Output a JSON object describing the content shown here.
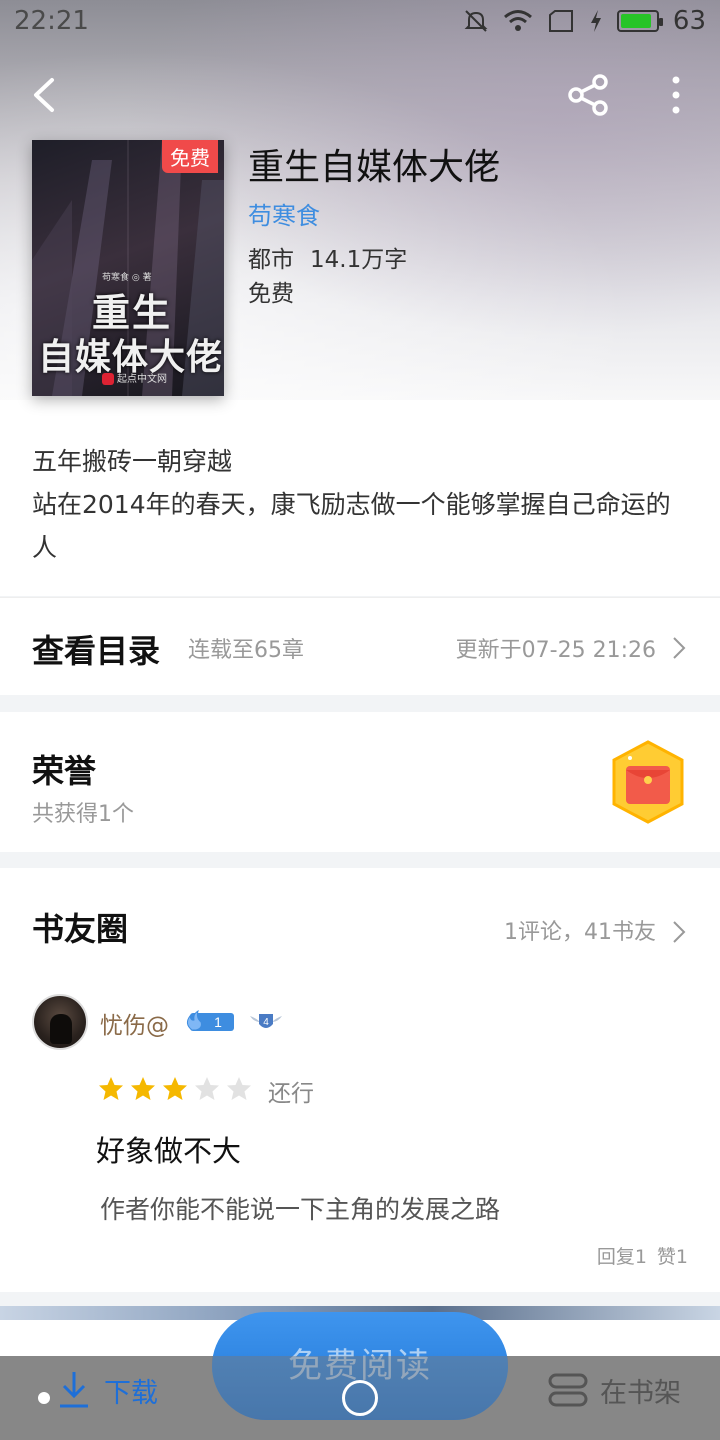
{
  "status_bar": {
    "time": "22:21",
    "battery": "63"
  },
  "book": {
    "cover_badge": "免费",
    "cover_author": "苟寒食 ◎ 著",
    "cover_title_line1": "重生",
    "cover_title_line2": "自媒体大佬",
    "cover_publisher": "起点中文网",
    "title": "重生自媒体大佬",
    "author": "苟寒食",
    "category": "都市",
    "word_count": "14.1万字",
    "price": "免费"
  },
  "intro": {
    "line1": "五年搬砖一朝穿越",
    "line2": "站在2014年的春天，康飞励志做一个能够掌握自己命运的人"
  },
  "toc": {
    "title": "查看目录",
    "progress": "连载至65章",
    "updated": "更新于07-25 21:26"
  },
  "honor": {
    "title": "荣誉",
    "count": "共获得1个"
  },
  "circle": {
    "title": "书友圈",
    "stats": "1评论，41书友",
    "review": {
      "username": "忧伤@",
      "fan_level": "1",
      "rank": "4",
      "rating": 3,
      "rating_max": 5,
      "rating_label": "还行",
      "title": "好象做不大",
      "body": "作者你能不能说一下主角的发展之路",
      "replies": "回复1",
      "likes": "赞1"
    }
  },
  "bottom": {
    "download_label": "下载",
    "read_label": "免费阅读",
    "shelf_label": "在书架"
  },
  "colors": {
    "accent": "#2a7fdc",
    "author_link": "#3e8de0",
    "star": "#f5b800"
  }
}
